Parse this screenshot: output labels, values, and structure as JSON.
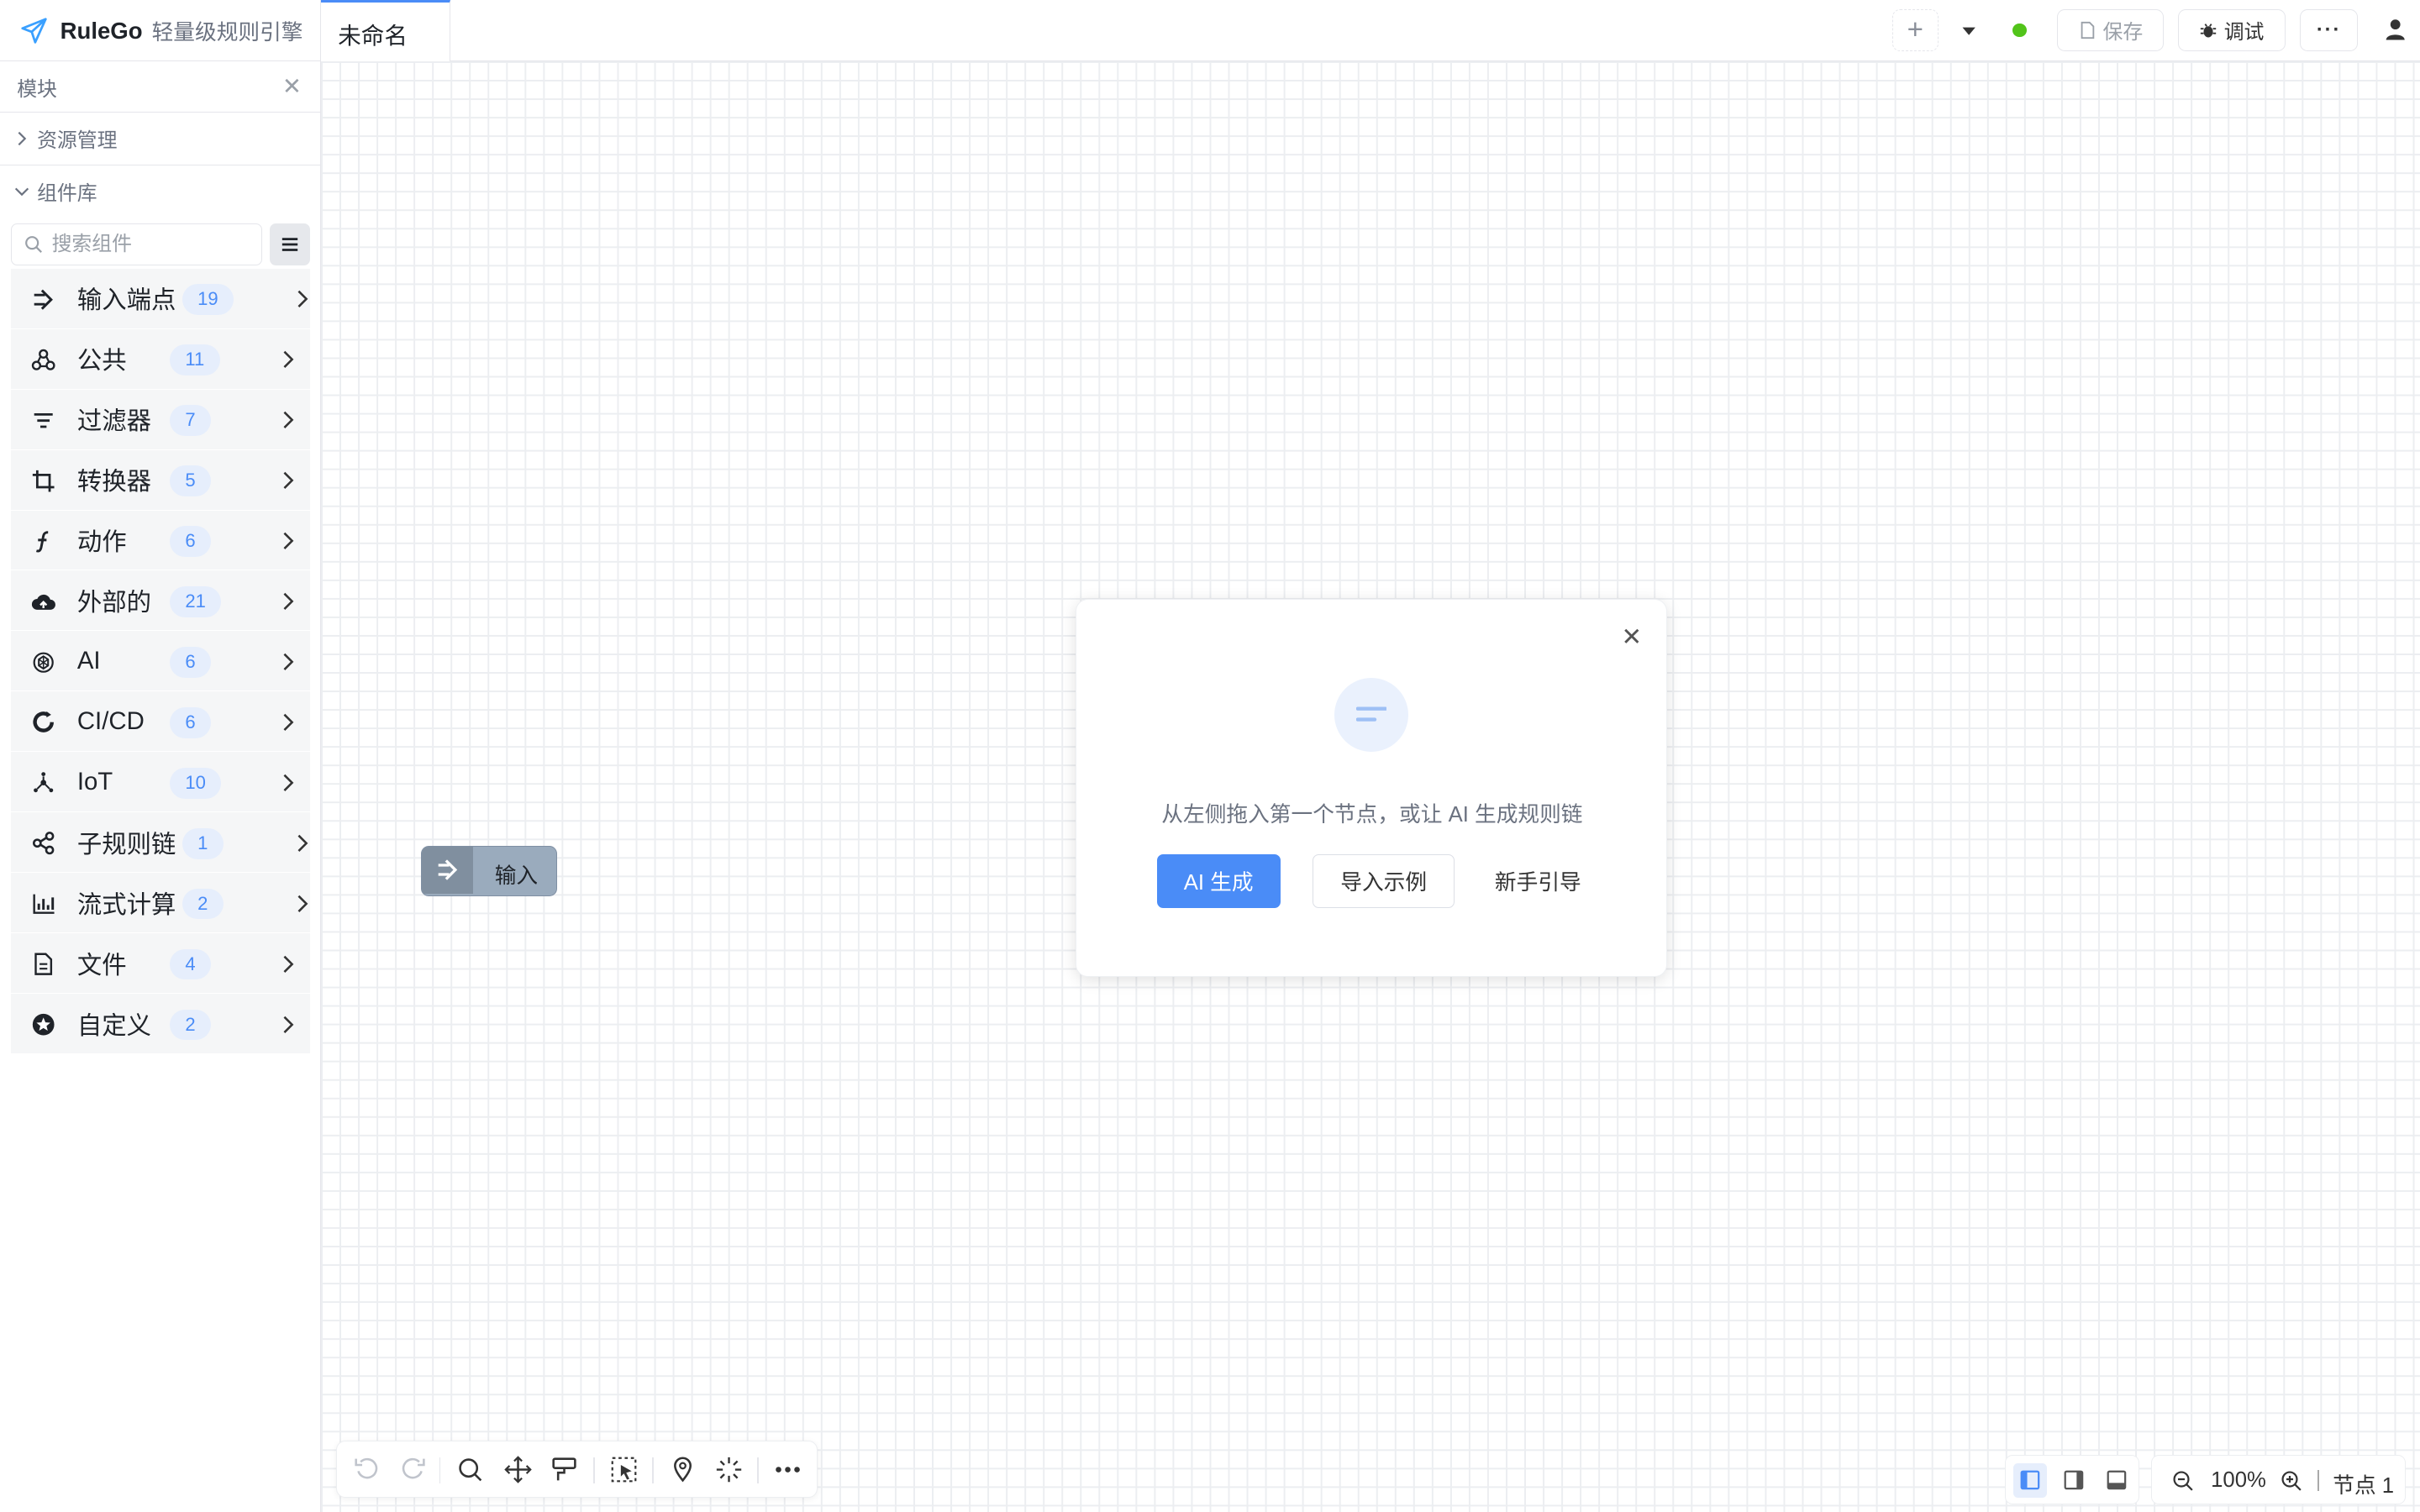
{
  "app": {
    "name": "RuleGo",
    "subtitle": "轻量级规则引擎"
  },
  "tabs": [
    {
      "label": "未命名",
      "active": true
    }
  ],
  "toolbar": {
    "add_label": "+",
    "save_label": "保存",
    "debug_label": "调试",
    "more_label": "···",
    "status_color": "#52c41a"
  },
  "sidebar": {
    "title": "模块",
    "close_label": "✕",
    "sections": [
      {
        "label": "资源管理",
        "expanded": false
      },
      {
        "label": "组件库",
        "expanded": true
      }
    ],
    "search_placeholder": "搜索组件",
    "categories": [
      {
        "label": "输入端点",
        "count": "19",
        "icon": "input-endpoint-icon"
      },
      {
        "label": "公共",
        "count": "11",
        "icon": "common-icon"
      },
      {
        "label": "过滤器",
        "count": "7",
        "icon": "filter-icon"
      },
      {
        "label": "转换器",
        "count": "5",
        "icon": "transform-icon"
      },
      {
        "label": "动作",
        "count": "6",
        "icon": "function-icon"
      },
      {
        "label": "外部的",
        "count": "21",
        "icon": "cloud-upload-icon"
      },
      {
        "label": "AI",
        "count": "6",
        "icon": "ai-icon"
      },
      {
        "label": "CI/CD",
        "count": "6",
        "icon": "cicd-icon"
      },
      {
        "label": "IoT",
        "count": "10",
        "icon": "iot-icon"
      },
      {
        "label": "子规则链",
        "count": "1",
        "icon": "share-icon"
      },
      {
        "label": "流式计算",
        "count": "2",
        "icon": "bar-chart-icon"
      },
      {
        "label": "文件",
        "count": "4",
        "icon": "file-icon"
      },
      {
        "label": "自定义",
        "count": "2",
        "icon": "star-icon"
      }
    ]
  },
  "canvas": {
    "node": {
      "label": "输入"
    }
  },
  "dialog": {
    "close_label": "✕",
    "message": "从左侧拖入第一个节点，或让 AI 生成规则链",
    "ai_button": "AI 生成",
    "import_button": "导入示例",
    "guide_button": "新手引导"
  },
  "statusbar": {
    "zoom": "100%",
    "node_count": "节点 1"
  },
  "colors": {
    "accent": "#4a8cf7",
    "badge_bg": "#e6eefc",
    "node_bg": "#9aabbd"
  }
}
